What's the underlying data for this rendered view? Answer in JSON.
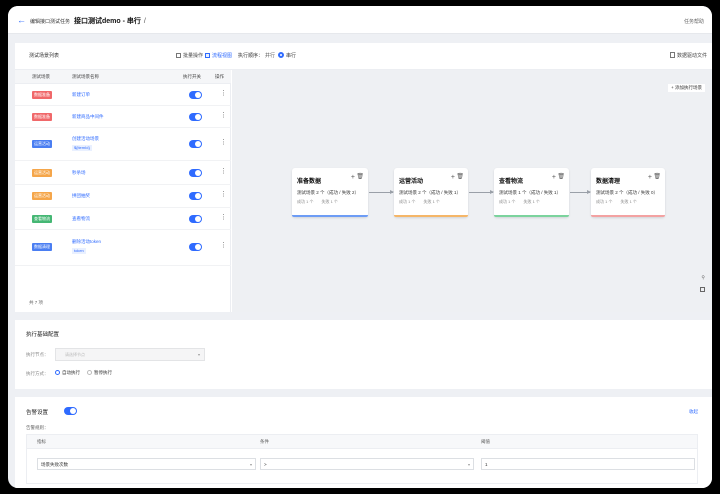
{
  "topbar": {
    "breadcrumb": "编辑接口测试任务",
    "title": "接口测试demo - 串行",
    "edit_glyph": "/",
    "help": "任务帮助"
  },
  "flow_section": {
    "list_title": "测试场景列表",
    "batch_label": "批量操作",
    "flow_view_label": "流程视图",
    "exec_order_label": "执行顺序：",
    "parallel_label": "并行",
    "serial_label": "串行",
    "data_file_label": "数据驱动文件",
    "columns": [
      "测试场景",
      "测试场景名称",
      "执行开关",
      "操作"
    ],
    "rows": [
      {
        "tag": "数据准备",
        "tag_color": "#f0686a",
        "name": "新建订单",
        "sub": ""
      },
      {
        "tag": "数据准备",
        "tag_color": "#f0686a",
        "name": "新建商品中间件",
        "sub": ""
      },
      {
        "tag": "运营活动",
        "tag_color": "#4a7ef2",
        "name": "创建活动场景",
        "sub": "${itemId}"
      },
      {
        "tag": "运营活动",
        "tag_color": "#f5a64a",
        "name": "秒杀场",
        "sub": ""
      },
      {
        "tag": "运营活动",
        "tag_color": "#f5a64a",
        "name": "拼团抽奖",
        "sub": ""
      },
      {
        "tag": "查看物流",
        "tag_color": "#45b774",
        "name": "查看物流",
        "sub": ""
      },
      {
        "tag": "数据清理",
        "tag_color": "#4a7ef2",
        "name": "删除活动token",
        "sub": "token"
      }
    ],
    "total": "共 7 项",
    "add_scene_button": "+ 添加执行场景",
    "nodes": [
      {
        "title": "准备数据",
        "line1": "测试场景 2 个（成功 / 失败 2）",
        "s1": "成功 1 个",
        "s2": "失败 1 个",
        "color": "#6d9cf5"
      },
      {
        "title": "运营活动",
        "line1": "测试场景 2 个（成功 / 失败 1）",
        "s1": "成功 1 个",
        "s2": "失败 1 个",
        "color": "#f5b668"
      },
      {
        "title": "查看物流",
        "line1": "测试场景 1 个（成功 / 失败 1）",
        "s1": "成功 1 个",
        "s2": "失败 1 个",
        "color": "#7bd39d"
      },
      {
        "title": "数据清理",
        "line1": "测试场景 2 个（成功 / 失败 0）",
        "s1": "成功 1 个",
        "s2": "失败 1 个",
        "color": "#f3a2a2"
      }
    ]
  },
  "exec_config": {
    "title": "执行基础配置",
    "exec_node_label": "执行节点：",
    "exec_node_placeholder": "请选择节点",
    "exec_mode_label": "执行方式：",
    "mode_auto": "自动执行",
    "mode_pause": "暂停执行"
  },
  "alert_config": {
    "title": "告警设置",
    "collapse": "收起",
    "rule_label": "告警规则：",
    "columns": [
      "指标",
      "条件",
      "阈值"
    ],
    "metric": "场景失败次数",
    "condition": ">",
    "threshold": "1"
  }
}
